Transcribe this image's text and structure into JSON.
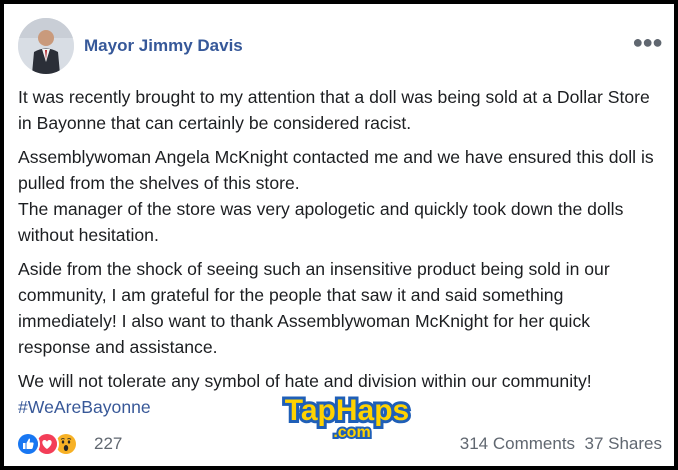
{
  "post": {
    "author": "Mayor Jimmy Davis",
    "paragraphs": [
      "It was recently brought to my attention that a doll was being sold at a Dollar Store in Bayonne that can certainly be considered racist.",
      "Assemblywoman Angela McKnight contacted me and we have ensured this doll is pulled from the shelves of this store.\nThe manager of the store was very apologetic and quickly took down the dolls without hesitation.",
      "Aside from the shock of seeing such an insensitive product being sold in our community, I am grateful for the people that saw it and said something immediately! I also want to thank Assemblywoman McKnight for her quick response and assistance.",
      "We will not tolerate any symbol of hate and division within our community!"
    ],
    "hashtag": "#WeAreBayonne"
  },
  "footer": {
    "reaction_count": "227",
    "comments": "314 Comments",
    "shares": "37 Shares"
  },
  "watermark": {
    "main": "TapHaps",
    "sub": ".com"
  },
  "icons": [
    "more-options-icon",
    "like-reaction-icon",
    "love-reaction-icon",
    "wow-reaction-icon"
  ],
  "colors": {
    "author_link": "#365899",
    "hashtag": "#385898",
    "like": "#1877f2",
    "love": "#f33e58",
    "wow": "#f7b125"
  }
}
